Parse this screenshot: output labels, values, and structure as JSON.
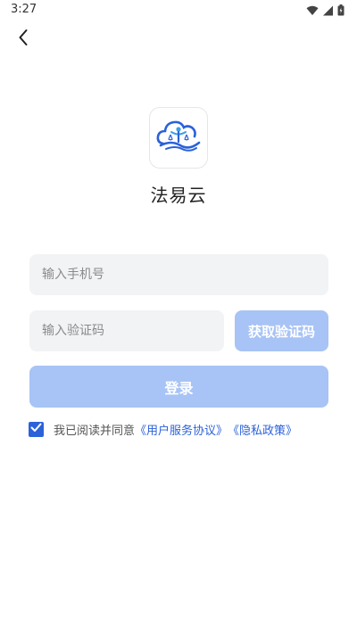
{
  "status_bar": {
    "time": "3:27"
  },
  "icons": {
    "back": "chevron-left-icon",
    "wifi": "wifi-icon",
    "signal": "signal-icon",
    "battery": "battery-icon",
    "logo": "cloud-scales-logo-icon",
    "check": "checkmark-icon"
  },
  "app": {
    "name": "法易云"
  },
  "form": {
    "phone_placeholder": "输入手机号",
    "code_placeholder": "输入验证码",
    "get_code_label": "获取验证码",
    "login_label": "登录"
  },
  "agreement": {
    "checked": true,
    "prefix": "我已阅读并同意",
    "user_agreement": "《用户服务协议》",
    "privacy_policy": "《隐私政策》"
  },
  "colors": {
    "accent": "#2b62d9",
    "button_disabled": "#a8c3f5",
    "input_bg": "#f2f3f5"
  }
}
